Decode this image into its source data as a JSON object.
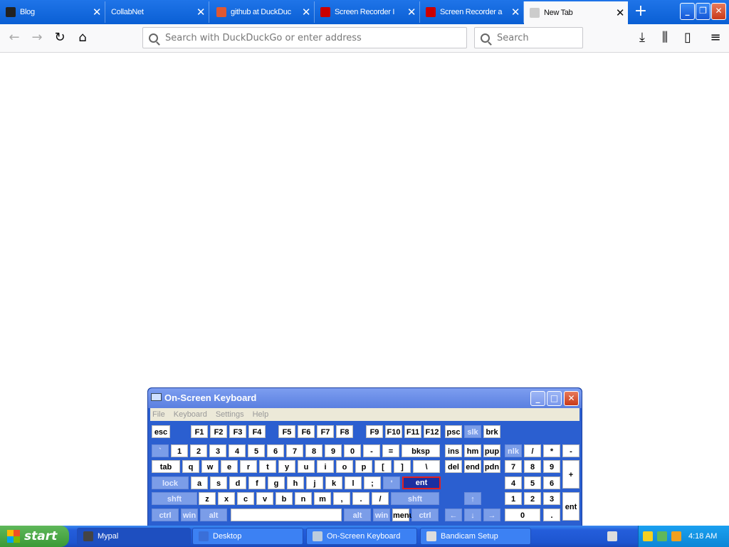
{
  "browser": {
    "tabs": [
      {
        "title": "Blog",
        "active": false
      },
      {
        "title": "CollabNet",
        "active": false
      },
      {
        "title": "github at DuckDuc",
        "active": false
      },
      {
        "title": "Screen Recorder I",
        "active": false
      },
      {
        "title": "Screen Recorder a",
        "active": false
      },
      {
        "title": "New Tab",
        "active": true
      }
    ],
    "urlbar_placeholder": "Search with DuckDuckGo or enter address",
    "search_placeholder": "Search"
  },
  "osk": {
    "title": "On-Screen Keyboard",
    "menu": [
      "File",
      "Keyboard",
      "Settings",
      "Help"
    ],
    "rows": [
      [
        {
          "l": "esc"
        },
        {
          "l": "F1"
        },
        {
          "l": "F2"
        },
        {
          "l": "F3"
        },
        {
          "l": "F4"
        },
        {
          "l": "F5"
        },
        {
          "l": "F6"
        },
        {
          "l": "F7"
        },
        {
          "l": "F8"
        },
        {
          "l": "F9"
        },
        {
          "l": "F10"
        },
        {
          "l": "F11"
        },
        {
          "l": "F12"
        },
        {
          "l": "psc"
        },
        {
          "l": "slk",
          "dk": true
        },
        {
          "l": "brk"
        }
      ],
      [
        {
          "l": "`",
          "dk": true
        },
        {
          "l": "1"
        },
        {
          "l": "2"
        },
        {
          "l": "3"
        },
        {
          "l": "4"
        },
        {
          "l": "5"
        },
        {
          "l": "6"
        },
        {
          "l": "7"
        },
        {
          "l": "8"
        },
        {
          "l": "9"
        },
        {
          "l": "0"
        },
        {
          "l": "-"
        },
        {
          "l": "="
        },
        {
          "l": "bksp"
        },
        {
          "l": "ins"
        },
        {
          "l": "hm"
        },
        {
          "l": "pup"
        },
        {
          "l": "nlk",
          "dk": true
        },
        {
          "l": "/"
        },
        {
          "l": "*"
        },
        {
          "l": "-"
        }
      ],
      [
        {
          "l": "tab"
        },
        {
          "l": "q"
        },
        {
          "l": "w"
        },
        {
          "l": "e"
        },
        {
          "l": "r"
        },
        {
          "l": "t"
        },
        {
          "l": "y"
        },
        {
          "l": "u"
        },
        {
          "l": "i"
        },
        {
          "l": "o"
        },
        {
          "l": "p"
        },
        {
          "l": "["
        },
        {
          "l": "]"
        },
        {
          "l": "\\"
        },
        {
          "l": "del"
        },
        {
          "l": "end"
        },
        {
          "l": "pdn"
        },
        {
          "l": "7"
        },
        {
          "l": "8"
        },
        {
          "l": "9"
        },
        {
          "l": "+"
        }
      ],
      [
        {
          "l": "lock",
          "dk": true
        },
        {
          "l": "a"
        },
        {
          "l": "s"
        },
        {
          "l": "d"
        },
        {
          "l": "f"
        },
        {
          "l": "g"
        },
        {
          "l": "h"
        },
        {
          "l": "j"
        },
        {
          "l": "k"
        },
        {
          "l": "l"
        },
        {
          "l": ";"
        },
        {
          "l": "'",
          "dk": true
        },
        {
          "l": "ent",
          "sel": true
        },
        {
          "l": "4"
        },
        {
          "l": "5"
        },
        {
          "l": "6"
        }
      ],
      [
        {
          "l": "shft",
          "dk": true
        },
        {
          "l": "z"
        },
        {
          "l": "x"
        },
        {
          "l": "c"
        },
        {
          "l": "v"
        },
        {
          "l": "b"
        },
        {
          "l": "n"
        },
        {
          "l": "m"
        },
        {
          "l": ","
        },
        {
          "l": "."
        },
        {
          "l": "/"
        },
        {
          "l": "shft",
          "dk": true
        },
        {
          "l": "↑",
          "dk": true
        },
        {
          "l": "1"
        },
        {
          "l": "2"
        },
        {
          "l": "3"
        },
        {
          "l": "ent"
        }
      ],
      [
        {
          "l": "ctrl",
          "dk": true
        },
        {
          "l": "win",
          "dk": true
        },
        {
          "l": "alt",
          "dk": true
        },
        {
          "l": " "
        },
        {
          "l": "alt",
          "dk": true
        },
        {
          "l": "win",
          "dk": true
        },
        {
          "l": "menu"
        },
        {
          "l": "ctrl",
          "dk": true
        },
        {
          "l": "←",
          "dk": true
        },
        {
          "l": "↓",
          "dk": true
        },
        {
          "l": "→",
          "dk": true
        },
        {
          "l": "0"
        },
        {
          "l": "."
        }
      ]
    ]
  },
  "taskbar": {
    "start": "start",
    "tasks": [
      {
        "label": "Mypal",
        "active": true
      },
      {
        "label": "Desktop",
        "active": false
      },
      {
        "label": "On-Screen Keyboard",
        "active": false
      },
      {
        "label": "Bandicam Setup",
        "active": false
      }
    ],
    "clock": "4:18 AM"
  }
}
